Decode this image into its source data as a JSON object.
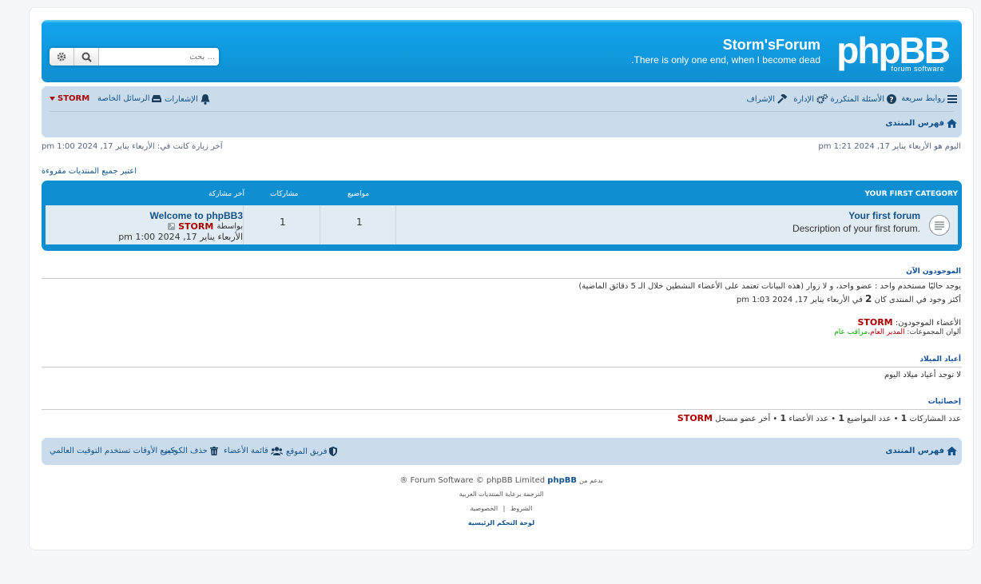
{
  "header": {
    "logo_text": "phpBB",
    "logo_sub": "forum software",
    "site_title": "Storm'sForum",
    "site_description": ".There is only one end, when I become dead",
    "search_placeholder": "بحث ..."
  },
  "navbar": {
    "quick_links": "روابط سريعة",
    "faq": "الأسئلة المتكررة",
    "acp": "الإدارة",
    "mcp": "الإشراف",
    "notifications": "الإشعارات",
    "private_messages": "الرسائل الخاصة",
    "username": "STORM",
    "breadcrumb_home": "فهرس المنتدى"
  },
  "times": {
    "current_time": "اليوم هو الأربعاء يناير 17, 2024 1:21 pm",
    "last_visit": "آخر زيارة كانت في: الأربعاء يناير 17, 2024 1:00 pm",
    "mark_read": "اعتبر جميع المنتديات مقروءة"
  },
  "forum_table": {
    "category": "YOUR FIRST CATEGORY",
    "col_topics": "مواضيع",
    "col_posts": "مشاركات",
    "col_last_post": "آخر مشاركة",
    "rows": [
      {
        "title": "Your first forum",
        "description": "Description of your first forum.",
        "topics": "1",
        "posts": "1",
        "last_post_title": "Welcome to phpBB3",
        "last_post_by": "بواسطة",
        "last_post_user": "STORM",
        "last_post_time": "الأربعاء يناير 17, 2024 1:00 pm"
      }
    ]
  },
  "online": {
    "heading": "الموجودون الآن",
    "line1": "يوجد حاليًا مستخدم واحد : عضو واحد، و لا زوار (هذه البيانات تعتمد على الأعضاء النشطين خلال الـ 5 دقائق الماضية)",
    "line2_prefix": "أكثر وجود في المنتدى كان",
    "line2_count": "2",
    "line2_suffix": "في الأربعاء يناير 17, 2024 1:03 pm",
    "members_label": "الأعضاء الموجودون:",
    "members_user": "STORM",
    "legend_label": "ألوان المجموعات:",
    "legend_admin": "المدير العام",
    "legend_mod": "مراقب عام"
  },
  "birthdays": {
    "heading": "أعياد الميلاد",
    "text": "لا توجد أعياد ميلاد اليوم"
  },
  "stats": {
    "heading": "إحصائيات",
    "posts_label": "عدد المشاركات",
    "posts": "1",
    "topics_label": "عدد المواضيع",
    "topics": "1",
    "members_label": "عدد الأعضاء",
    "members": "1",
    "newest_label": "أخر عضو مسجل",
    "newest": "STORM"
  },
  "footer_nav": {
    "home": "فهرس المنتدى",
    "team": "فريق الموقع",
    "members": "قائمة الأعضاء",
    "delete_cookies": "حذف الكوكيز",
    "timezone": "جميع الأوقات تستخدم التوقيت العالمي"
  },
  "copyright": {
    "powered_prefix": "بدعم من",
    "phpbb": "phpBB",
    "powered_suffix": "® Forum Software © phpBB Limited",
    "translation": "الترجمة برعاية المنتديات العربية",
    "privacy": "الخصوصية",
    "terms": "الشروط",
    "acp_link": "لوحة التحكم الرئيسية"
  },
  "colors": {
    "header_blue": "#0f8fd1",
    "nav_bg": "#cadceb",
    "link": "#105289",
    "username_red": "#aa0000",
    "mod_green": "#00aa00"
  }
}
